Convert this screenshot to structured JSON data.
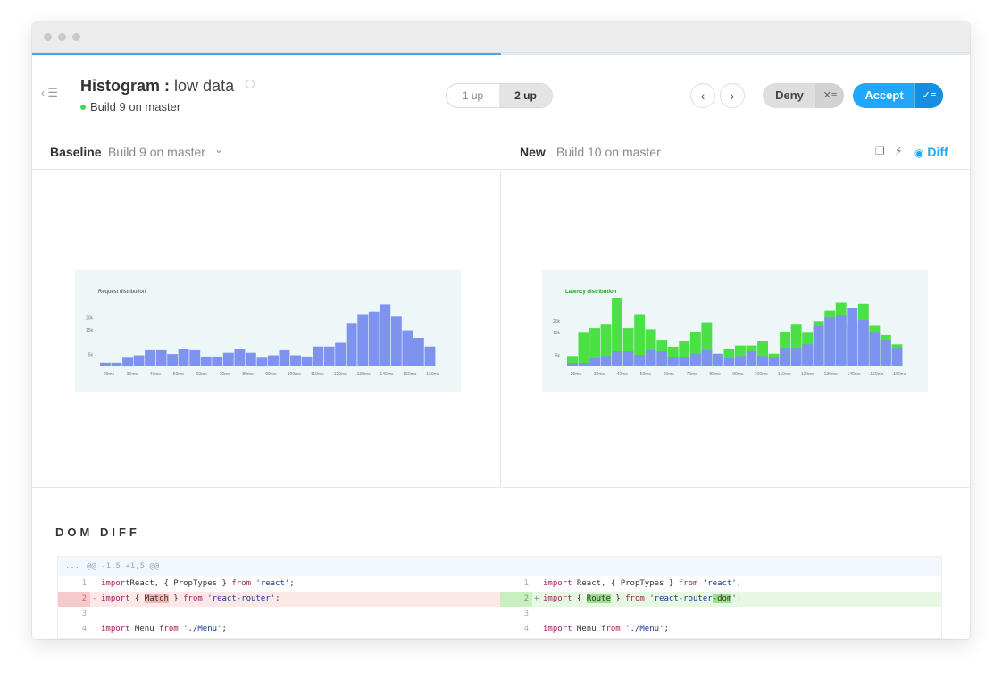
{
  "titlebar": {
    "dots": 3
  },
  "progress": {
    "fraction": 0.5
  },
  "header": {
    "title_bold": "Histogram :",
    "title_rest": "low data",
    "build": "Build 9 on master",
    "toggle": {
      "one_up": "1 up",
      "two_up": "2 up",
      "selected": "2 up"
    },
    "deny_label": "Deny",
    "accept_label": "Accept"
  },
  "compare": {
    "baseline_label": "Baseline",
    "baseline_value": "Build 9 on master",
    "new_label": "New",
    "new_value": "Build 10 on master",
    "diff_label": "Diff"
  },
  "chart_data": [
    {
      "type": "bar",
      "title": "Request distribution",
      "categories": [
        "20ms",
        "25ms",
        "30ms",
        "35ms",
        "40ms",
        "45ms",
        "50ms",
        "55ms",
        "60ms",
        "65ms",
        "70ms",
        "75ms",
        "80ms",
        "85ms",
        "90ms",
        "95ms",
        "100ms",
        "105ms",
        "110ms",
        "115ms",
        "120ms",
        "125ms",
        "130ms",
        "135ms",
        "140ms",
        "145ms",
        "150ms",
        "155ms",
        "160ms"
      ],
      "tick_labels": [
        "20ms",
        "30ms",
        "40ms",
        "50ms",
        "60ms",
        "70ms",
        "80ms",
        "90ms",
        "100ms",
        "110ms",
        "120ms",
        "130ms",
        "140ms",
        "150ms",
        "160ms"
      ],
      "y_ticks": [
        "5k",
        "15k",
        "20k"
      ],
      "values": [
        1500,
        1500,
        3500,
        4500,
        6500,
        6500,
        5000,
        7000,
        6500,
        4000,
        4000,
        5500,
        7000,
        5500,
        3500,
        4500,
        6500,
        4500,
        4000,
        8000,
        8000,
        9500,
        17500,
        21000,
        22000,
        25000,
        20000,
        14500,
        11500,
        8000
      ],
      "ylim": [
        0,
        28000
      ],
      "color": "#7e93ee"
    },
    {
      "type": "bar",
      "title": "Latency distribution",
      "categories": [
        "20ms",
        "25ms",
        "30ms",
        "35ms",
        "40ms",
        "45ms",
        "50ms",
        "55ms",
        "60ms",
        "65ms",
        "70ms",
        "75ms",
        "80ms",
        "85ms",
        "90ms",
        "95ms",
        "100ms",
        "105ms",
        "110ms",
        "115ms",
        "120ms",
        "125ms",
        "130ms",
        "135ms",
        "140ms",
        "145ms",
        "150ms",
        "155ms",
        "160ms"
      ],
      "tick_labels": [
        "20ms",
        "30ms",
        "40ms",
        "50ms",
        "60ms",
        "70ms",
        "80ms",
        "90ms",
        "100ms",
        "110ms",
        "120ms",
        "130ms",
        "140ms",
        "150ms",
        "160ms"
      ],
      "y_ticks": [
        "5k",
        "15k",
        "20k"
      ],
      "series": [
        {
          "values": [
            1500,
            1500,
            3500,
            4500,
            6500,
            6500,
            5000,
            7000,
            6500,
            4000,
            4000,
            5500,
            7000,
            5500,
            3500,
            4500,
            6500,
            4500,
            4000,
            8000,
            8000,
            9500,
            17500,
            21000,
            22000,
            25000,
            20000,
            14500,
            11500,
            8000
          ],
          "color": "#7e93ee"
        },
        {
          "values": [
            4500,
            14500,
            16500,
            18000,
            29500,
            16500,
            22500,
            16000,
            11500,
            8500,
            11000,
            15000,
            19000,
            5000,
            7500,
            9000,
            9000,
            11000,
            5500,
            15000,
            18000,
            14500,
            19500,
            24000,
            27500,
            17500,
            27000,
            17500,
            13500,
            9500
          ],
          "color": "#4be046"
        }
      ],
      "ylim": [
        0,
        30000
      ]
    }
  ],
  "dom_diff": {
    "title": "DOM DIFF",
    "hunk_dots": "...",
    "hunk": "@@ -1,5 +1,5 @@",
    "left": [
      {
        "n": "1",
        "type": "ctx",
        "parts": [
          [
            "kw",
            "import"
          ],
          [
            "",
            "React, { PropTypes } "
          ],
          [
            "kw",
            "from"
          ],
          [
            "str",
            " 'react'"
          ],
          [
            "",
            ";"
          ]
        ]
      },
      {
        "n": "2",
        "type": "del",
        "parts": [
          [
            "kw",
            "import"
          ],
          [
            "",
            " { "
          ],
          [
            "hl-del",
            "Match"
          ],
          [
            "",
            " } "
          ],
          [
            "kw",
            "from"
          ],
          [
            "str",
            " 'react-router'"
          ],
          [
            "",
            ";"
          ]
        ]
      },
      {
        "n": "3",
        "type": "ctx",
        "parts": []
      },
      {
        "n": "4",
        "type": "ctx",
        "parts": [
          [
            "kw",
            "import"
          ],
          [
            "",
            " Menu "
          ],
          [
            "kw",
            "from"
          ],
          [
            "str",
            " './Menu'"
          ],
          [
            "",
            ";"
          ]
        ]
      }
    ],
    "right": [
      {
        "n": "1",
        "type": "ctx",
        "parts": [
          [
            "kw",
            "import"
          ],
          [
            "",
            " React, { PropTypes } "
          ],
          [
            "kw",
            "from"
          ],
          [
            "str",
            " 'react'"
          ],
          [
            "",
            ";"
          ]
        ]
      },
      {
        "n": "2",
        "type": "add",
        "parts": [
          [
            "kw",
            "import"
          ],
          [
            "",
            " { "
          ],
          [
            "hl-add",
            "Route"
          ],
          [
            "",
            " } "
          ],
          [
            "kw",
            "from"
          ],
          [
            "str",
            " 'react-router"
          ],
          [
            "hl-add",
            "-dom"
          ],
          [
            "str",
            "'"
          ],
          [
            "",
            ";"
          ]
        ]
      },
      {
        "n": "3",
        "type": "ctx",
        "parts": []
      },
      {
        "n": "4",
        "type": "ctx",
        "parts": [
          [
            "kw",
            "import"
          ],
          [
            "",
            " Menu "
          ],
          [
            "kw",
            "from"
          ],
          [
            "str",
            " './Menu'"
          ],
          [
            "",
            ";"
          ]
        ]
      }
    ]
  }
}
